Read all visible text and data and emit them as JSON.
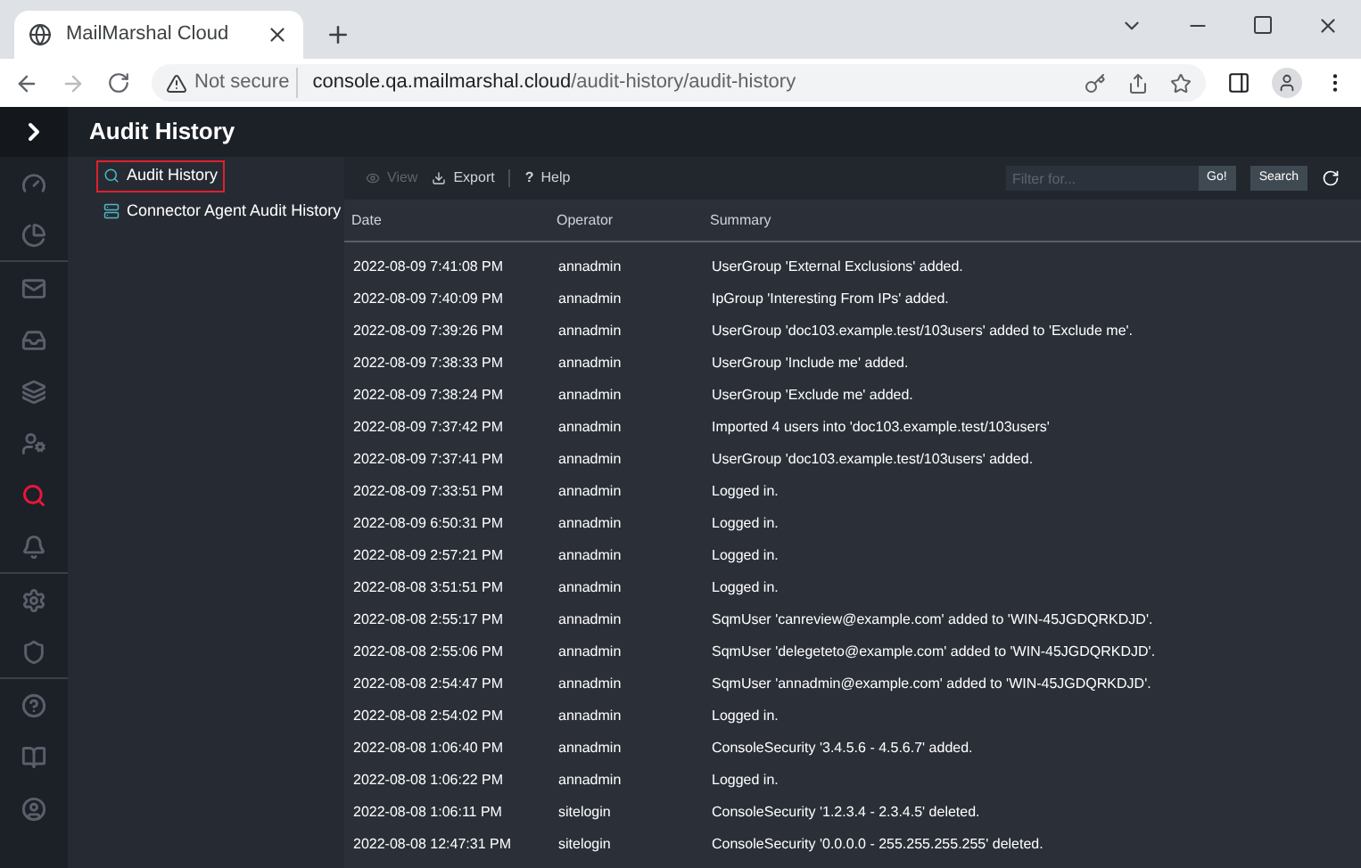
{
  "browser": {
    "tab_title": "MailMarshal Cloud",
    "security": "Not secure",
    "url_host": "console.qa.mailmarshal.cloud",
    "url_path": "/audit-history/audit-history"
  },
  "rail": [
    {
      "kind": "gauge",
      "selected": false
    },
    {
      "kind": "pie",
      "selected": false,
      "divider": true
    },
    {
      "kind": "mail",
      "selected": false
    },
    {
      "kind": "inbox",
      "selected": false
    },
    {
      "kind": "layers",
      "selected": false
    },
    {
      "kind": "usercog",
      "selected": false
    },
    {
      "kind": "search",
      "selected": true
    },
    {
      "kind": "bell",
      "selected": false,
      "divider": true
    },
    {
      "kind": "gear",
      "selected": false
    },
    {
      "kind": "shield",
      "selected": false,
      "divider": true
    },
    {
      "kind": "help",
      "selected": false
    },
    {
      "kind": "book",
      "selected": false
    },
    {
      "kind": "user",
      "selected": false
    }
  ],
  "page_title": "Audit History",
  "nav": [
    {
      "label": "Audit History",
      "kind": "search",
      "selected": true
    },
    {
      "label": "Connector Agent Audit History",
      "kind": "agent",
      "selected": false
    }
  ],
  "toolbar": {
    "view": "View",
    "export": "Export",
    "help_mark": "?",
    "help": "Help",
    "filter_placeholder": "Filter for...",
    "go": "Go!",
    "search": "Search"
  },
  "table": {
    "columns": [
      "Date",
      "Operator",
      "Summary"
    ],
    "rows": [
      [
        "2022-08-09 7:41:08 PM",
        "annadmin",
        "UserGroup 'External Exclusions' added."
      ],
      [
        "2022-08-09 7:40:09 PM",
        "annadmin",
        "IpGroup 'Interesting From IPs' added."
      ],
      [
        "2022-08-09 7:39:26 PM",
        "annadmin",
        "UserGroup 'doc103.example.test/103users' added to 'Exclude me'."
      ],
      [
        "2022-08-09 7:38:33 PM",
        "annadmin",
        "UserGroup 'Include me' added."
      ],
      [
        "2022-08-09 7:38:24 PM",
        "annadmin",
        "UserGroup 'Exclude me' added."
      ],
      [
        "2022-08-09 7:37:42 PM",
        "annadmin",
        "Imported 4 users into 'doc103.example.test/103users'"
      ],
      [
        "2022-08-09 7:37:41 PM",
        "annadmin",
        "UserGroup 'doc103.example.test/103users' added."
      ],
      [
        "2022-08-09 7:33:51 PM",
        "annadmin",
        "Logged in."
      ],
      [
        "2022-08-09 6:50:31 PM",
        "annadmin",
        "Logged in."
      ],
      [
        "2022-08-09 2:57:21 PM",
        "annadmin",
        "Logged in."
      ],
      [
        "2022-08-08 3:51:51 PM",
        "annadmin",
        "Logged in."
      ],
      [
        "2022-08-08 2:55:17 PM",
        "annadmin",
        "SqmUser 'canreview@example.com' added to 'WIN-45JGDQRKDJD'."
      ],
      [
        "2022-08-08 2:55:06 PM",
        "annadmin",
        "SqmUser 'delegeteto@example.com' added to 'WIN-45JGDQRKDJD'."
      ],
      [
        "2022-08-08 2:54:47 PM",
        "annadmin",
        "SqmUser 'annadmin@example.com' added to 'WIN-45JGDQRKDJD'."
      ],
      [
        "2022-08-08 2:54:02 PM",
        "annadmin",
        "Logged in."
      ],
      [
        "2022-08-08 1:06:40 PM",
        "annadmin",
        "ConsoleSecurity '3.4.5.6 - 4.5.6.7' added."
      ],
      [
        "2022-08-08 1:06:22 PM",
        "annadmin",
        "Logged in."
      ],
      [
        "2022-08-08 1:06:11 PM",
        "sitelogin",
        "ConsoleSecurity '1.2.3.4 - 2.3.4.5' deleted."
      ],
      [
        "2022-08-08 12:47:31 PM",
        "sitelogin",
        "ConsoleSecurity '0.0.0.0 - 255.255.255.255' deleted."
      ]
    ]
  }
}
